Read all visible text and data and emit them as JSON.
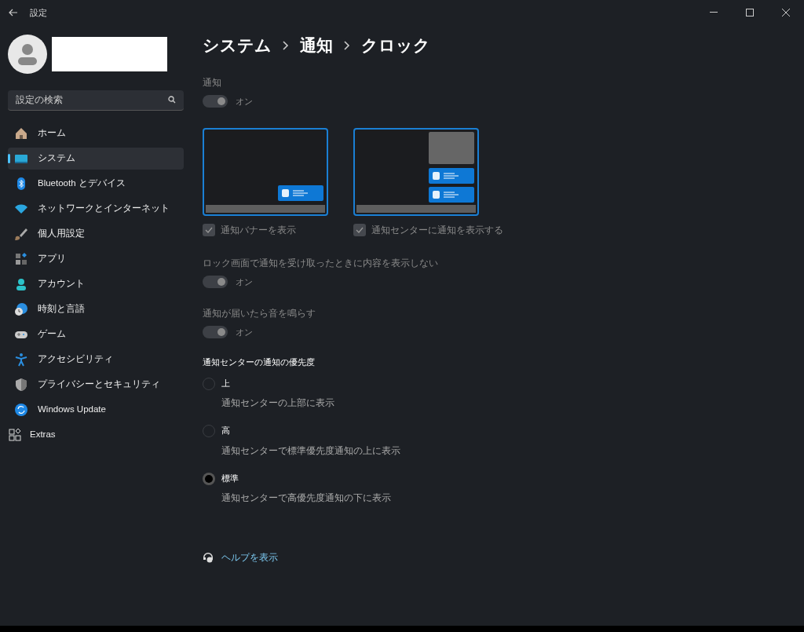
{
  "window": {
    "title": "設定"
  },
  "sidebar": {
    "search": {
      "placeholder": "設定の検索"
    },
    "items": [
      {
        "kind": "home",
        "label": "ホーム",
        "selected": false
      },
      {
        "kind": "system",
        "label": "システム",
        "selected": true
      },
      {
        "kind": "bluetooth",
        "label": "Bluetooth とデバイス",
        "selected": false
      },
      {
        "kind": "network",
        "label": "ネットワークとインターネット",
        "selected": false
      },
      {
        "kind": "personalize",
        "label": "個人用設定",
        "selected": false
      },
      {
        "kind": "apps",
        "label": "アプリ",
        "selected": false
      },
      {
        "kind": "account",
        "label": "アカウント",
        "selected": false
      },
      {
        "kind": "time",
        "label": "時刻と言語",
        "selected": false
      },
      {
        "kind": "game",
        "label": "ゲーム",
        "selected": false
      },
      {
        "kind": "accessibility",
        "label": "アクセシビリティ",
        "selected": false
      },
      {
        "kind": "privacy",
        "label": "プライバシーとセキュリティ",
        "selected": false
      },
      {
        "kind": "update",
        "label": "Windows Update",
        "selected": false
      },
      {
        "kind": "extras",
        "label": "Extras",
        "selected": false
      }
    ]
  },
  "breadcrumb": [
    "システム",
    "通知",
    "クロック"
  ],
  "notifications": {
    "label": "通知",
    "toggle": {
      "on": true,
      "disabled": true,
      "text": "オン"
    }
  },
  "previews": [
    {
      "kind": "banner",
      "checkbox": {
        "label": "通知バナーを表示",
        "checked": true,
        "disabled": true
      }
    },
    {
      "kind": "center",
      "checkbox": {
        "label": "通知センターに通知を表示する",
        "checked": true,
        "disabled": true
      }
    }
  ],
  "settings": [
    {
      "label": "ロック画面で通知を受け取ったときに内容を表示しない",
      "toggle": {
        "on": true,
        "disabled": true,
        "text": "オン"
      }
    },
    {
      "label": "通知が届いたら音を鳴らす",
      "toggle": {
        "on": true,
        "disabled": true,
        "text": "オン"
      }
    }
  ],
  "priority": {
    "title": "通知センターの通知の優先度",
    "options": [
      {
        "label": "上",
        "description": "通知センターの上部に表示",
        "selected": false
      },
      {
        "label": "高",
        "description": "通知センターで標準優先度通知の上に表示",
        "selected": false
      },
      {
        "label": "標準",
        "description": "通知センターで高優先度通知の下に表示",
        "selected": true
      }
    ]
  },
  "help": {
    "label": "ヘルプを表示"
  }
}
